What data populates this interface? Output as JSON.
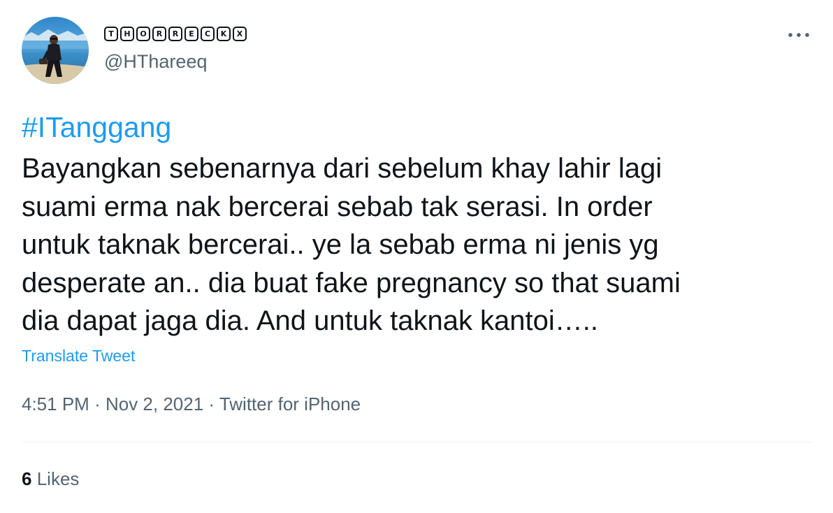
{
  "tweet": {
    "author": {
      "display_name_letters": [
        "T",
        "H",
        "O",
        "R",
        "R",
        "E",
        "C",
        "K",
        "X"
      ],
      "handle": "@HThareeq"
    },
    "hashtag": "#ITanggang",
    "body_lines": [
      "Bayangkan sebenarnya dari sebelum khay lahir lagi",
      "suami erma nak bercerai sebab tak serasi. In order",
      "untuk taknak bercerai.. ye la sebab erma ni jenis yg",
      "desperate an.. dia buat fake pregnancy so that suami",
      "dia dapat jaga dia. And untuk taknak kantoi….."
    ],
    "translate_label": "Translate Tweet",
    "time": "4:51 PM",
    "separator": "·",
    "date": "Nov 2, 2021",
    "source": "Twitter for iPhone",
    "likes_count": "6",
    "likes_label": "Likes"
  },
  "icons": {
    "more": "more-horizontal-icon"
  },
  "colors": {
    "link": "#1d9bf0",
    "primary_text": "#0f1419",
    "secondary_text": "#536471",
    "divider": "#eff3f4"
  }
}
